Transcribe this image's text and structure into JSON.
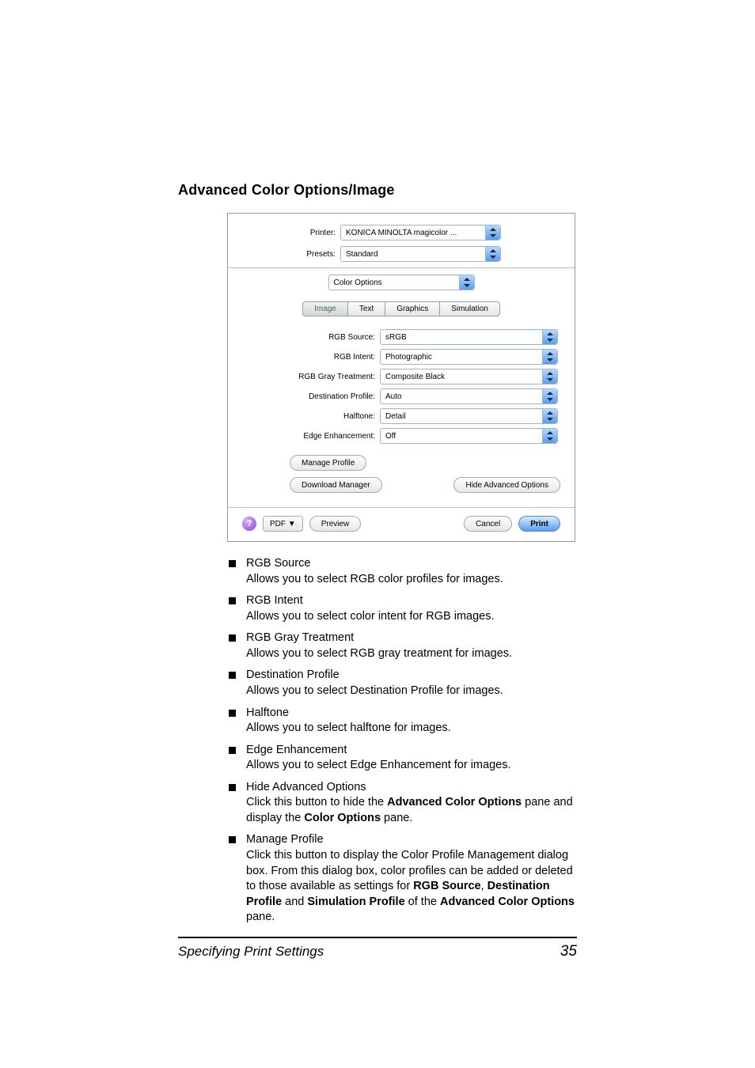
{
  "heading": "Advanced Color Options/Image",
  "dialog": {
    "printer_label": "Printer:",
    "printer_value": "KONICA MINOLTA magicolor ...",
    "presets_label": "Presets:",
    "presets_value": "Standard",
    "pane_value": "Color Options",
    "tabs": {
      "image": "Image",
      "text": "Text",
      "graphics": "Graphics",
      "simulation": "Simulation"
    },
    "fields": {
      "rgb_source": {
        "label": "RGB Source:",
        "value": "sRGB"
      },
      "rgb_intent": {
        "label": "RGB Intent:",
        "value": "Photographic"
      },
      "rgb_gray": {
        "label": "RGB Gray Treatment:",
        "value": "Composite Black"
      },
      "dest_profile": {
        "label": "Destination Profile:",
        "value": "Auto"
      },
      "halftone": {
        "label": "Halftone:",
        "value": "Detail"
      },
      "edge": {
        "label": "Edge Enhancement:",
        "value": "Off"
      }
    },
    "manage_profile": "Manage Profile",
    "download_manager": "Download Manager",
    "hide_advanced": "Hide Advanced Options",
    "help": "?",
    "pdf": "PDF ▼",
    "preview": "Preview",
    "cancel": "Cancel",
    "print": "Print"
  },
  "items": {
    "a": {
      "title": "RGB Source",
      "desc": "Allows you to select RGB color profiles for images."
    },
    "b": {
      "title": "RGB Intent",
      "desc": "Allows you to select color intent for RGB images."
    },
    "c": {
      "title": "RGB Gray Treatment",
      "desc": "Allows you to select RGB gray treatment for images."
    },
    "d": {
      "title": "Destination Profile",
      "desc": "Allows you to select Destination Profile for images."
    },
    "e": {
      "title": "Halftone",
      "desc": "Allows you to select halftone for images."
    },
    "f": {
      "title": "Edge Enhancement",
      "desc": "Allows you to select Edge Enhancement for images."
    },
    "g": {
      "title": "Hide Advanced Options",
      "pre": "Click this button to hide the ",
      "b1": "Advanced Color Options",
      "mid": " pane and display the ",
      "b2": "Color Options",
      "post": " pane."
    },
    "h": {
      "title": "Manage Profile",
      "l1": "Click this button to display the Color Profile Management dialog box. From this dialog box, color profiles can be added or deleted to those available as settings for ",
      "b1": "RGB Source",
      "c1": ", ",
      "b2": "Destination Profile",
      "a1": " and ",
      "b3": "Simulation Profile",
      "of": " of the ",
      "b4": "Advanced Color Options",
      "end": " pane."
    }
  },
  "footer": {
    "title": "Specifying Print Settings",
    "page": "35"
  }
}
